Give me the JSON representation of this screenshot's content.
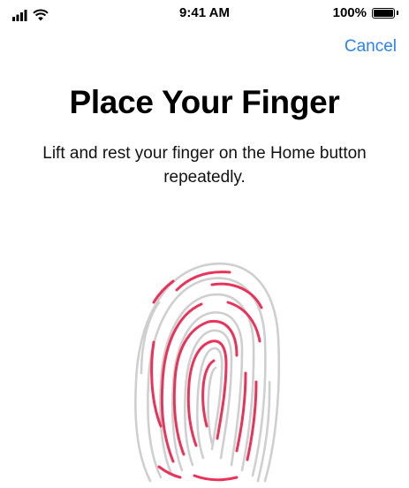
{
  "status_bar": {
    "signal_icon": "signal-bars-icon",
    "wifi_icon": "wifi-icon",
    "time": "9:41 AM",
    "battery_percent": "100%",
    "battery_level": 1.0,
    "battery_icon": "battery-icon"
  },
  "nav": {
    "cancel_label": "Cancel",
    "accent_color": "#2b82f0"
  },
  "main": {
    "title": "Place Your Finger",
    "instruction": "Lift and rest your finger on the Home button repeatedly."
  },
  "fingerprint": {
    "icon": "fingerprint-icon",
    "progress_color": "#e8345a",
    "inactive_color": "#cfcfcf"
  }
}
